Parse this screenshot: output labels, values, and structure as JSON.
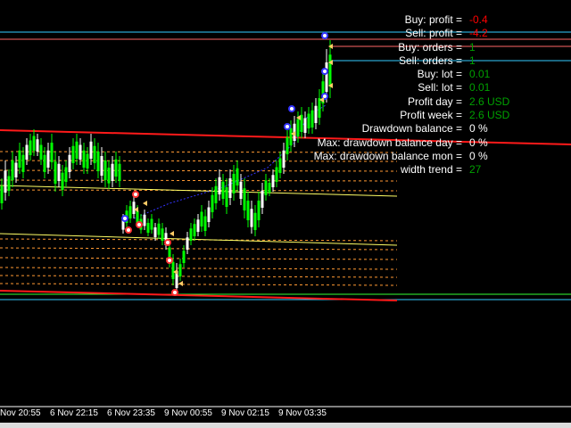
{
  "colors": {
    "background": "#000000",
    "bull_candle": "#00ff00",
    "bear_candle": "#ffffff",
    "channel_red": "#ff1a1a",
    "level_yellow": "#ffff66",
    "level_orange_dotted": "#ff9933",
    "line_cyan": "#33ccff",
    "line_green": "#33ff33",
    "line_pink": "#ff6666",
    "label_white": "#ffffff",
    "value_red": "#ff0000",
    "value_green": "#00a000",
    "trend_blue_dotted": "#3333ff"
  },
  "time_axis": {
    "labels": [
      "Nov 20:55",
      "6 Nov 22:15",
      "6 Nov 23:35",
      "9 Nov 00:55",
      "9 Nov 02:15",
      "9 Nov 03:35"
    ]
  },
  "info_panel": [
    {
      "label": "Buy: profit =",
      "value": "-0.4",
      "value_color": "#ff0000"
    },
    {
      "label": "Sell: profit =",
      "value": "-4.2",
      "value_color": "#ff0000"
    },
    {
      "label": "Buy: orders =",
      "value": "1",
      "value_color": "#00a000"
    },
    {
      "label": "Sell: orders =",
      "value": "1",
      "value_color": "#00a000"
    },
    {
      "label": "Buy: lot =",
      "value": "0.01",
      "value_color": "#00a000"
    },
    {
      "label": "Sell: lot =",
      "value": "0.01",
      "value_color": "#00a000"
    },
    {
      "label": "Profit day =",
      "value": "2.6  USD",
      "value_color": "#00a000"
    },
    {
      "label": "Profit week =",
      "value": "2.6  USD",
      "value_color": "#00a000"
    },
    {
      "label": "Drawdown balance =",
      "value": "0 %",
      "value_color": "#ffffff"
    },
    {
      "label": "Max: drawdown balance day =",
      "value": "0 %",
      "value_color": "#ffffff"
    },
    {
      "label": "Max: drawdown balance mon =",
      "value": "0 %",
      "value_color": "#ffffff"
    },
    {
      "label": "width trend =",
      "value": "27",
      "value_color": "#00a000"
    }
  ]
}
